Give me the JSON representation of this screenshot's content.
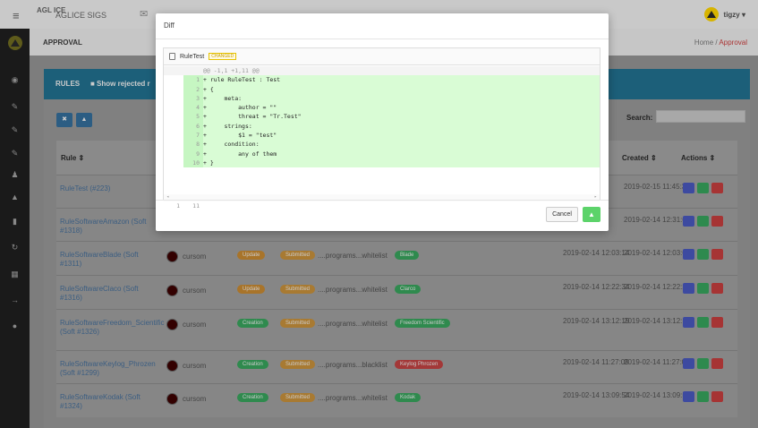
{
  "topbar": {
    "menu_icon": "hamburger-icon",
    "logo_text": "AGL ICE",
    "app_title": "AGLICE SIGS",
    "mail_icon": "mail-icon",
    "user_name": "tigzy ▾"
  },
  "sidebar": {
    "icons": [
      "dashboard-icon",
      "pencil-icon",
      "pencil-icon",
      "pencil-icon",
      "user-icon",
      "thumbs-up-icon",
      "bar-chart-icon",
      "refresh-icon",
      "building-icon",
      "arrow-right-icon",
      "globe-icon"
    ]
  },
  "subheader": {
    "title": "APPROVAL",
    "breadcrumb_home": "Home",
    "breadcrumb_sep": "/",
    "breadcrumb_current": "Approval"
  },
  "card": {
    "title": "RULES",
    "show_rejected": "■ Show rejected r",
    "search_label": "Search:"
  },
  "table": {
    "headers": {
      "rule": "Rule ⇕",
      "created": "Created ⇕",
      "actions": "Actions ⇕"
    },
    "rows": [
      {
        "rule": "RuleTest (#223)",
        "user": "",
        "d1": "",
        "d2": "2019-02-15 11:45:30",
        "type": "",
        "status": "",
        "path": "",
        "tag": ""
      },
      {
        "rule": "RuleSoftwareAmazon (Soft #1318)",
        "user": "",
        "d1": "",
        "d2": "2019-02-14 12:31:03",
        "type": "",
        "status": "",
        "path": "",
        "tag": ""
      },
      {
        "rule": "RuleSoftwareBlade (Soft #1311)",
        "user": "cursom",
        "d1": "2019-02-14 12:03:14",
        "d2": "2019-02-14 12:03:09",
        "type": "Update",
        "status": "Submitted",
        "path": "....programs...whitelist",
        "tag": "Blade"
      },
      {
        "rule": "RuleSoftwareClaco (Soft #1316)",
        "user": "cursom",
        "d1": "2019-02-14 12:22:34",
        "d2": "2019-02-14 12:22:29",
        "type": "Update",
        "status": "Submitted",
        "path": "....programs...whitelist",
        "tag": "Clarco"
      },
      {
        "rule": "RuleSoftwareFreedom_Scientific (Soft #1326)",
        "user": "cursom",
        "d1": "2019-02-14 13:12:19",
        "d2": "2019-02-14 13:12:14",
        "type": "Creation",
        "status": "Submitted",
        "path": "....programs...whitelist",
        "tag": "Freedom Scientific"
      },
      {
        "rule": "RuleSoftwareKeylog_Phrozen (Soft #1299)",
        "user": "cursom",
        "d1": "2019-02-14 11:27:09",
        "d2": "2019-02-14 11:27:03",
        "type": "Creation",
        "status": "Submitted",
        "path": "....programs...blacklist",
        "tag": "Keylog Phrozen"
      },
      {
        "rule": "RuleSoftwareKodak (Soft #1324)",
        "user": "cursom",
        "d1": "2019-02-14 13:09:54",
        "d2": "2019-02-14 13:09:50",
        "type": "Creation",
        "status": "Submitted",
        "path": "....programs...whitelist",
        "tag": "Kodak"
      }
    ]
  },
  "colors": {
    "pill_update": "#a8742a",
    "pill_creation": "#2f8a4e",
    "pill_submitted": "#a87a32",
    "tag_green": "#2f8a4e",
    "tag_red": "#a33838",
    "act_blue": "#3d4aa0",
    "act_green": "#2e8a4e",
    "act_red": "#a63434"
  },
  "modal": {
    "title": "Diff",
    "file_name": "RuleTest",
    "file_badge": "CHANGED",
    "hunk_header": "@@ -1,1 +1,11 @@",
    "lines": [
      {
        "n1": "",
        "n2": "1",
        "code": "+ rule RuleTest : Test"
      },
      {
        "n1": "",
        "n2": "2",
        "code": "+ {"
      },
      {
        "n1": "",
        "n2": "3",
        "code": "+     meta:"
      },
      {
        "n1": "",
        "n2": "4",
        "code": "+         author = \"\""
      },
      {
        "n1": "",
        "n2": "5",
        "code": "+         threat = \"Tr.Test\""
      },
      {
        "n1": "",
        "n2": "6",
        "code": "+     strings:"
      },
      {
        "n1": "",
        "n2": "7",
        "code": "+         $1 = \"test\""
      },
      {
        "n1": "",
        "n2": "8",
        "code": "+     condition:"
      },
      {
        "n1": "",
        "n2": "9",
        "code": "+         any of them"
      },
      {
        "n1": "",
        "n2": "10",
        "code": "+ }"
      }
    ],
    "last_line": {
      "n1": "1",
      "n2": "11",
      "code": ""
    },
    "cancel_label": "Cancel",
    "approve_icon": "thumbs-up-icon"
  }
}
